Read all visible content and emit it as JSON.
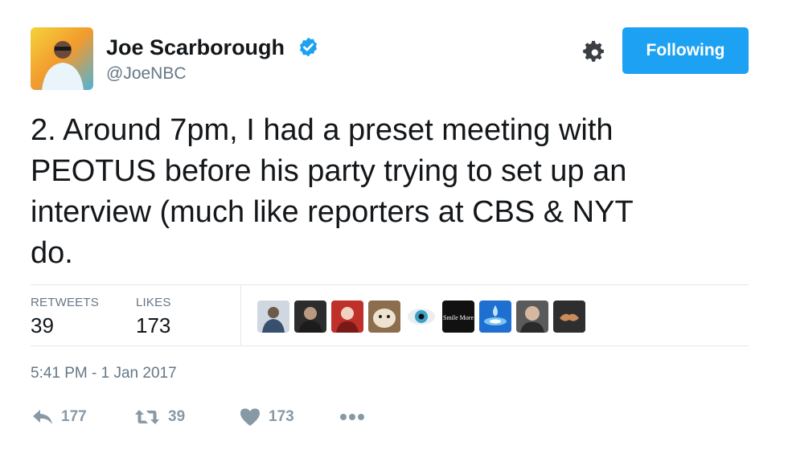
{
  "user": {
    "display_name": "Joe Scarborough",
    "handle": "@JoeNBC",
    "verified": true,
    "avatar_icon": "profile-photo"
  },
  "header": {
    "settings_icon": "gear-icon",
    "follow_label": "Following",
    "follow_color": "#1da1f2"
  },
  "tweet": {
    "lines": [
      "2. Around 7pm, I had a preset meeting with",
      "PEOTUS before his party trying to set up an",
      "interview (much like reporters at CBS & NYT",
      "do."
    ]
  },
  "stats": {
    "retweets_label": "RETWEETS",
    "retweets_count": "39",
    "likes_label": "LIKES",
    "likes_count": "173"
  },
  "likers": [
    {
      "name": "liker-avatar-1",
      "color": "#8aa0b8"
    },
    {
      "name": "liker-avatar-2",
      "color": "#3a3a3a"
    },
    {
      "name": "liker-avatar-3",
      "color": "#c0302a"
    },
    {
      "name": "liker-avatar-4",
      "color": "#d9c3a0"
    },
    {
      "name": "liker-avatar-5",
      "color": "#5fa8c8"
    },
    {
      "name": "liker-avatar-6",
      "color": "#111111",
      "text": "Smile More"
    },
    {
      "name": "liker-avatar-7",
      "color": "#1f6fd0"
    },
    {
      "name": "liker-avatar-8",
      "color": "#5a5a5a"
    },
    {
      "name": "liker-avatar-9",
      "color": "#2e2e2e"
    }
  ],
  "timestamp": "5:41 PM - 1 Jan 2017",
  "actions": {
    "reply_count": "177",
    "retweet_count": "39",
    "like_count": "173",
    "more_icon": "more-dots-icon"
  }
}
